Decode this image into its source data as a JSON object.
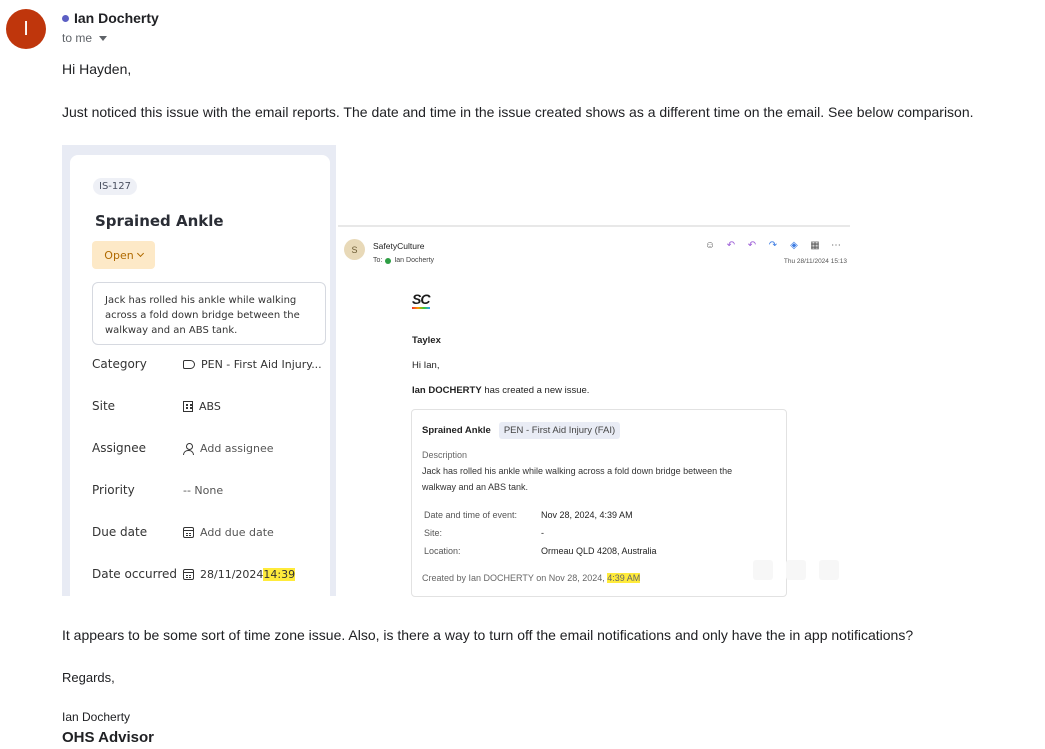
{
  "sender": {
    "avatar_letter": "I",
    "name": "Ian Docherty",
    "to": "to me"
  },
  "body": {
    "greeting": "Hi Hayden,",
    "para1": "Just noticed this issue with the email reports. The date and time in the issue created shows as a different time on the email. See below comparison.",
    "para2": "It appears to be some sort of time zone issue. Also, is there a way to turn off the email notifications and only have the in app notifications?",
    "regards": "Regards,",
    "sig_name": "Ian Docherty",
    "sig_title": "OHS Advisor"
  },
  "issue": {
    "id": "IS-127",
    "title": "Sprained Ankle",
    "status": "Open",
    "description": "Jack has rolled his ankle while walking across a fold down bridge between the walkway and an ABS tank.",
    "fields": [
      {
        "label": "Category",
        "value": "PEN - First Aid Injury..."
      },
      {
        "label": "Site",
        "value": "ABS"
      },
      {
        "label": "Assignee",
        "value": "Add assignee"
      },
      {
        "label": "Priority",
        "value": "-- None"
      },
      {
        "label": "Due date",
        "value": "Add due date"
      },
      {
        "label": "Date occurred",
        "value_date": "28/11/2024",
        "value_time": "14:39"
      }
    ]
  },
  "email": {
    "avatar_letter": "S",
    "sender": "SafetyCulture",
    "to": "To:",
    "to_name": "Ian Docherty",
    "date": "Thu 28/11/2024 15:13",
    "logo": "SC",
    "org": "Taylex",
    "greeting": "Hi Ian,",
    "creator": "Ian DOCHERTY",
    "created_text": "has created a new issue.",
    "card": {
      "title": "Sprained Ankle",
      "chip": "PEN - First Aid Injury (FAI)",
      "desc_label": "Description",
      "desc_line1": "Jack has rolled his ankle while walking across a fold down bridge between the",
      "desc_line2": "walkway and an ABS tank.",
      "rows": [
        {
          "k": "Date and time of event:",
          "v": "Nov 28, 2024, 4:39 AM"
        },
        {
          "k": "Site:",
          "v": "-"
        },
        {
          "k": "Location:",
          "v": "Ormeau QLD 4208, Australia"
        }
      ],
      "created_prefix": "Created by Ian DOCHERTY on Nov 28, 2024,",
      "created_time": "4:39 AM"
    }
  },
  "colors": {
    "avatar": "#bf360c",
    "status_bg": "#fde9c7",
    "highlight": "#ffeb3b"
  }
}
